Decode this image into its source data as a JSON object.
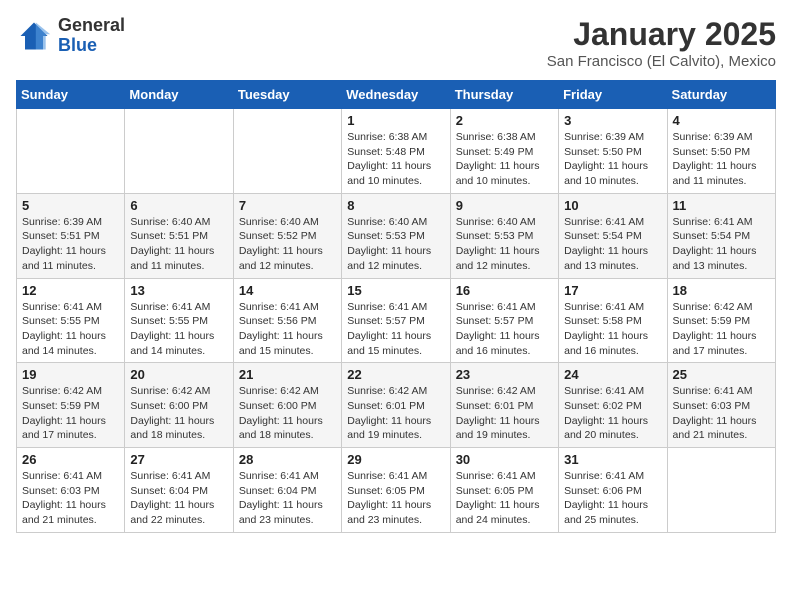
{
  "logo": {
    "general": "General",
    "blue": "Blue"
  },
  "header": {
    "month": "January 2025",
    "location": "San Francisco (El Calvito), Mexico"
  },
  "weekdays": [
    "Sunday",
    "Monday",
    "Tuesday",
    "Wednesday",
    "Thursday",
    "Friday",
    "Saturday"
  ],
  "weeks": [
    [
      {
        "day": "",
        "info": ""
      },
      {
        "day": "",
        "info": ""
      },
      {
        "day": "",
        "info": ""
      },
      {
        "day": "1",
        "info": "Sunrise: 6:38 AM\nSunset: 5:48 PM\nDaylight: 11 hours\nand 10 minutes."
      },
      {
        "day": "2",
        "info": "Sunrise: 6:38 AM\nSunset: 5:49 PM\nDaylight: 11 hours\nand 10 minutes."
      },
      {
        "day": "3",
        "info": "Sunrise: 6:39 AM\nSunset: 5:50 PM\nDaylight: 11 hours\nand 10 minutes."
      },
      {
        "day": "4",
        "info": "Sunrise: 6:39 AM\nSunset: 5:50 PM\nDaylight: 11 hours\nand 11 minutes."
      }
    ],
    [
      {
        "day": "5",
        "info": "Sunrise: 6:39 AM\nSunset: 5:51 PM\nDaylight: 11 hours\nand 11 minutes."
      },
      {
        "day": "6",
        "info": "Sunrise: 6:40 AM\nSunset: 5:51 PM\nDaylight: 11 hours\nand 11 minutes."
      },
      {
        "day": "7",
        "info": "Sunrise: 6:40 AM\nSunset: 5:52 PM\nDaylight: 11 hours\nand 12 minutes."
      },
      {
        "day": "8",
        "info": "Sunrise: 6:40 AM\nSunset: 5:53 PM\nDaylight: 11 hours\nand 12 minutes."
      },
      {
        "day": "9",
        "info": "Sunrise: 6:40 AM\nSunset: 5:53 PM\nDaylight: 11 hours\nand 12 minutes."
      },
      {
        "day": "10",
        "info": "Sunrise: 6:41 AM\nSunset: 5:54 PM\nDaylight: 11 hours\nand 13 minutes."
      },
      {
        "day": "11",
        "info": "Sunrise: 6:41 AM\nSunset: 5:54 PM\nDaylight: 11 hours\nand 13 minutes."
      }
    ],
    [
      {
        "day": "12",
        "info": "Sunrise: 6:41 AM\nSunset: 5:55 PM\nDaylight: 11 hours\nand 14 minutes."
      },
      {
        "day": "13",
        "info": "Sunrise: 6:41 AM\nSunset: 5:55 PM\nDaylight: 11 hours\nand 14 minutes."
      },
      {
        "day": "14",
        "info": "Sunrise: 6:41 AM\nSunset: 5:56 PM\nDaylight: 11 hours\nand 15 minutes."
      },
      {
        "day": "15",
        "info": "Sunrise: 6:41 AM\nSunset: 5:57 PM\nDaylight: 11 hours\nand 15 minutes."
      },
      {
        "day": "16",
        "info": "Sunrise: 6:41 AM\nSunset: 5:57 PM\nDaylight: 11 hours\nand 16 minutes."
      },
      {
        "day": "17",
        "info": "Sunrise: 6:41 AM\nSunset: 5:58 PM\nDaylight: 11 hours\nand 16 minutes."
      },
      {
        "day": "18",
        "info": "Sunrise: 6:42 AM\nSunset: 5:59 PM\nDaylight: 11 hours\nand 17 minutes."
      }
    ],
    [
      {
        "day": "19",
        "info": "Sunrise: 6:42 AM\nSunset: 5:59 PM\nDaylight: 11 hours\nand 17 minutes."
      },
      {
        "day": "20",
        "info": "Sunrise: 6:42 AM\nSunset: 6:00 PM\nDaylight: 11 hours\nand 18 minutes."
      },
      {
        "day": "21",
        "info": "Sunrise: 6:42 AM\nSunset: 6:00 PM\nDaylight: 11 hours\nand 18 minutes."
      },
      {
        "day": "22",
        "info": "Sunrise: 6:42 AM\nSunset: 6:01 PM\nDaylight: 11 hours\nand 19 minutes."
      },
      {
        "day": "23",
        "info": "Sunrise: 6:42 AM\nSunset: 6:01 PM\nDaylight: 11 hours\nand 19 minutes."
      },
      {
        "day": "24",
        "info": "Sunrise: 6:41 AM\nSunset: 6:02 PM\nDaylight: 11 hours\nand 20 minutes."
      },
      {
        "day": "25",
        "info": "Sunrise: 6:41 AM\nSunset: 6:03 PM\nDaylight: 11 hours\nand 21 minutes."
      }
    ],
    [
      {
        "day": "26",
        "info": "Sunrise: 6:41 AM\nSunset: 6:03 PM\nDaylight: 11 hours\nand 21 minutes."
      },
      {
        "day": "27",
        "info": "Sunrise: 6:41 AM\nSunset: 6:04 PM\nDaylight: 11 hours\nand 22 minutes."
      },
      {
        "day": "28",
        "info": "Sunrise: 6:41 AM\nSunset: 6:04 PM\nDaylight: 11 hours\nand 23 minutes."
      },
      {
        "day": "29",
        "info": "Sunrise: 6:41 AM\nSunset: 6:05 PM\nDaylight: 11 hours\nand 23 minutes."
      },
      {
        "day": "30",
        "info": "Sunrise: 6:41 AM\nSunset: 6:05 PM\nDaylight: 11 hours\nand 24 minutes."
      },
      {
        "day": "31",
        "info": "Sunrise: 6:41 AM\nSunset: 6:06 PM\nDaylight: 11 hours\nand 25 minutes."
      },
      {
        "day": "",
        "info": ""
      }
    ]
  ]
}
